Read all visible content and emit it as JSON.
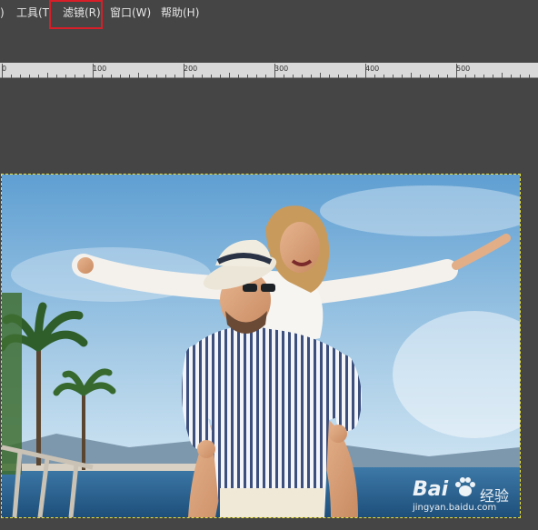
{
  "menubar": {
    "items": [
      {
        "label": ")"
      },
      {
        "label": "工具(T"
      },
      {
        "label": "滤镜(R)"
      },
      {
        "label": "窗口(W)"
      },
      {
        "label": "帮助(H)"
      }
    ],
    "highlighted_item": "滤镜(R)",
    "highlight_color": "#d81e28"
  },
  "ruler": {
    "labels": [
      "0",
      "100",
      "200",
      "300",
      "400",
      "500"
    ]
  },
  "canvas": {
    "background": "#454545",
    "selection_color": "#e8e23b"
  },
  "watermark": {
    "brand": "Bai",
    "brand_suffix": "经验",
    "url": "jingyan.baidu.com",
    "icon": "paw-icon"
  }
}
